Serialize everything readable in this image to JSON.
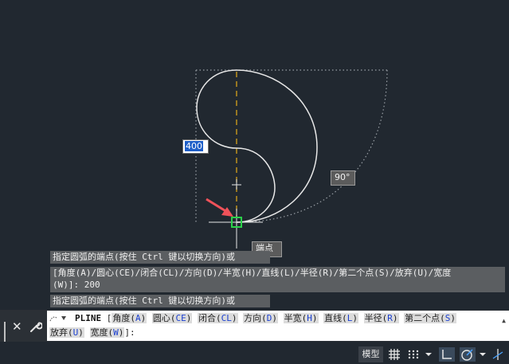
{
  "drawing": {
    "dyn_input_value": "400",
    "angle_tooltip": "90°",
    "endpoint_tooltip": "端点"
  },
  "command_history": {
    "line1": "指定圆弧的端点(按住 Ctrl 键以切换方向)或",
    "line2a": "[角度(A)/圆心(CE)/闭合(CL)/方向(D)/半宽(H)/直线(L)/半径(R)/第二个点(S)/放弃(U)/宽度",
    "line2b": "(W)]: 200",
    "line3": "指定圆弧的端点(按住 Ctrl 键以切换方向)或"
  },
  "command_line": {
    "command": "PLINE",
    "open_bracket": "[",
    "close": "]:",
    "options": [
      {
        "label": "角度",
        "key": "A"
      },
      {
        "label": "圆心",
        "key": "CE"
      },
      {
        "label": "闭合",
        "key": "CL"
      },
      {
        "label": "方向",
        "key": "D"
      },
      {
        "label": "半宽",
        "key": "H"
      },
      {
        "label": "直线",
        "key": "L"
      },
      {
        "label": "半径",
        "key": "R"
      },
      {
        "label": "第二个点",
        "key": "S"
      },
      {
        "label": "放弃",
        "key": "U"
      },
      {
        "label": "宽度",
        "key": "W"
      }
    ]
  },
  "status_bar": {
    "model_label": "模型"
  },
  "icons": {
    "close": "close-icon",
    "wrench": "wrench-icon",
    "grid": "grid-icon",
    "snap": "snap-grid-icon",
    "ortho": "ortho-icon",
    "polar": "polar-tracking-icon"
  },
  "colors": {
    "background": "#212830",
    "arc": "#e8e8e8",
    "center_line": "#d6a21b",
    "marker": "#2bd14a",
    "arrow": "#f0525a",
    "dyn_highlight": "#1f5fc8",
    "option_key": "#1a3fd0"
  }
}
